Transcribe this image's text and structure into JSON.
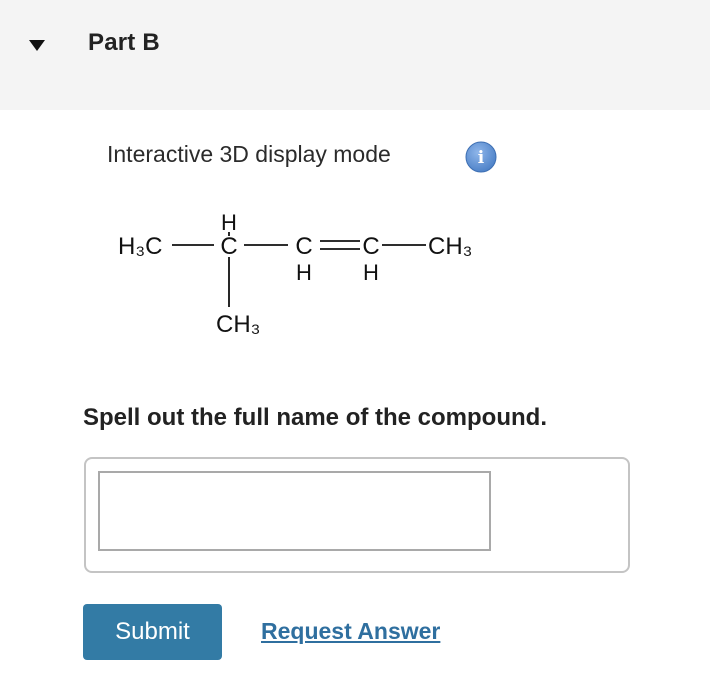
{
  "header": {
    "toggle_icon": "triangle-down-icon",
    "title": "Part B",
    "background": "#f4f4f4"
  },
  "display_mode": {
    "label": "Interactive 3D display mode",
    "info_icon": "info-icon",
    "info_glyph": "i",
    "info_color": "#5b8fd3"
  },
  "structure": {
    "left_methyl": "H₃C",
    "carbons": [
      "C",
      "C",
      "C"
    ],
    "hydrogens": [
      "H",
      "H",
      "H"
    ],
    "right_methyl": "CH₃",
    "branch_methyl": "CH₃"
  },
  "question": {
    "prompt": "Spell out the full name of the compound."
  },
  "answer": {
    "value": "",
    "placeholder": ""
  },
  "actions": {
    "submit_label": "Submit",
    "request_answer_label": "Request Answer",
    "submit_color": "#337ba5",
    "link_color": "#2f6f9f"
  }
}
